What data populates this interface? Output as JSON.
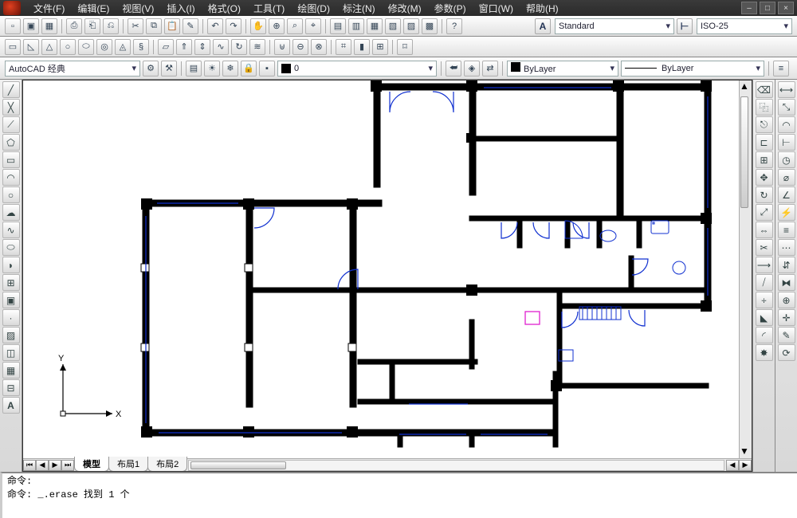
{
  "menu": {
    "items": [
      "文件(F)",
      "编辑(E)",
      "视图(V)",
      "插入(I)",
      "格式(O)",
      "工具(T)",
      "绘图(D)",
      "标注(N)",
      "修改(M)",
      "参数(P)",
      "窗口(W)",
      "帮助(H)"
    ]
  },
  "win": {
    "min": "–",
    "max": "□",
    "close": "×"
  },
  "style_panel": {
    "text_style": "Standard",
    "dim_style": "ISO-25"
  },
  "props": {
    "workspace": "AutoCAD 经典",
    "layer_current": "0",
    "color_current": "ByLayer",
    "linetype_current": "ByLayer"
  },
  "tabs": {
    "model": "模型",
    "layout1": "布局1",
    "layout2": "布局2"
  },
  "cmd": {
    "prompt1": "命令:",
    "prompt2": "命令: _.erase 找到 1 个"
  },
  "ucs": {
    "x": "X",
    "y": "Y"
  },
  "icons": {
    "text_style": "A",
    "dim_style": "⊢",
    "ws_gear": "⚙",
    "ws_wrench": "⚒",
    "layer_mgr": "▤"
  }
}
